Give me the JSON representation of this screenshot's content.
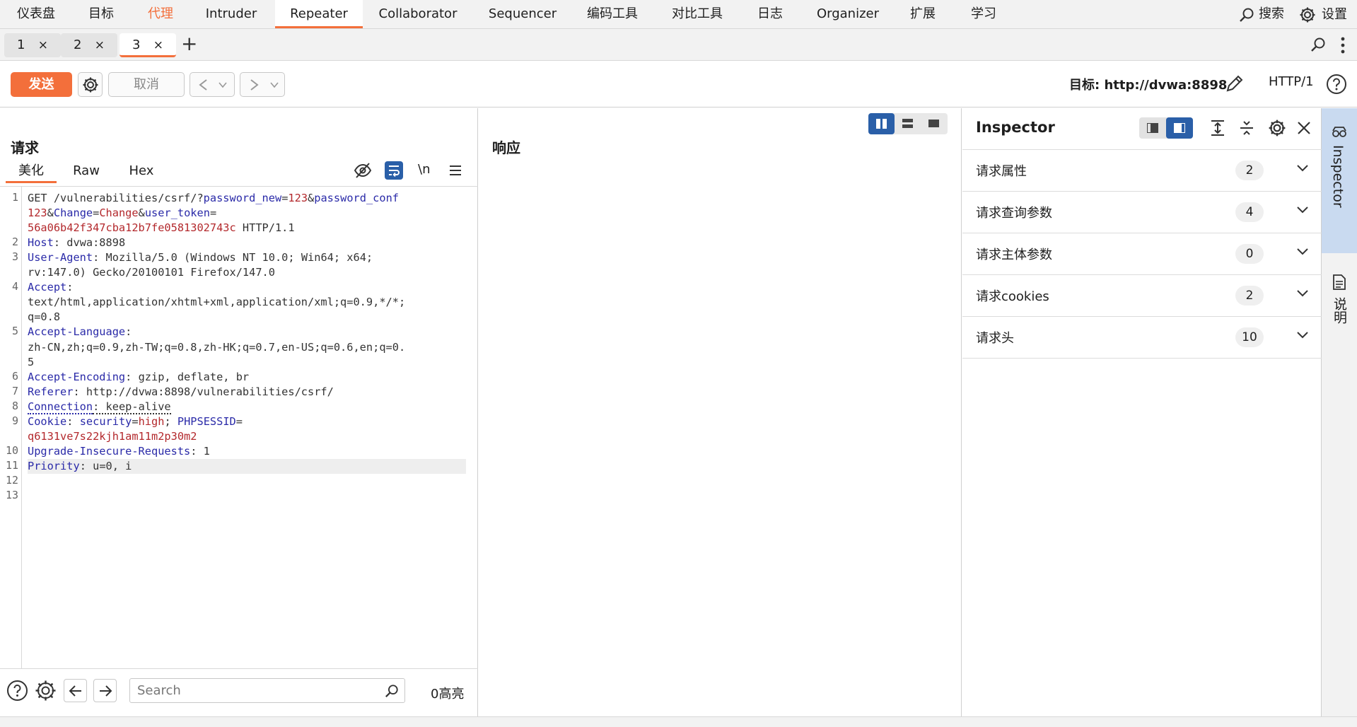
{
  "menu": {
    "items": [
      "仪表盘",
      "目标",
      "代理",
      "Intruder",
      "Repeater",
      "Collaborator",
      "Sequencer",
      "编码工具",
      "对比工具",
      "日志",
      "Organizer",
      "扩展",
      "学习"
    ],
    "search_label": "搜索",
    "settings_label": "设置"
  },
  "tabs": {
    "items": [
      "1",
      "2",
      "3"
    ],
    "close": "×",
    "add": "+"
  },
  "toolbar": {
    "send_label": "发送",
    "cancel_label": "取消",
    "target_label": "目标: http://dvwa:8898",
    "http_version": "HTTP/1"
  },
  "request": {
    "title": "请求",
    "subtabs": [
      "美化",
      "Raw",
      "Hex"
    ],
    "newline_toggle": "\\n",
    "line_numbers": [
      "1",
      "2",
      "3",
      "4",
      "5",
      "6",
      "7",
      "8",
      "9",
      "10",
      "11",
      "12",
      "13"
    ],
    "lines": [
      [
        {
          "t": "GET /vulnerabilities/csrf/?",
          "c": ""
        },
        {
          "t": "password_new",
          "c": "k"
        },
        {
          "t": "=",
          "c": ""
        },
        {
          "t": "123",
          "c": "v"
        },
        {
          "t": "&",
          "c": ""
        },
        {
          "t": "password_conf",
          "c": "k"
        }
      ],
      [
        {
          "t": "123",
          "c": "v"
        },
        {
          "t": "&",
          "c": ""
        },
        {
          "t": "Change",
          "c": "k"
        },
        {
          "t": "=",
          "c": ""
        },
        {
          "t": "Change",
          "c": "v"
        },
        {
          "t": "&",
          "c": ""
        },
        {
          "t": "user_token",
          "c": "k"
        },
        {
          "t": "=",
          "c": ""
        }
      ],
      [
        {
          "t": "56a06b42f347cba12b7fe0581302743c",
          "c": "v"
        },
        {
          "t": " HTTP/1.1",
          "c": ""
        }
      ],
      [
        {
          "t": "Host",
          "c": "k"
        },
        {
          "t": ": dvwa:8898",
          "c": ""
        }
      ],
      [
        {
          "t": "User-Agent",
          "c": "k"
        },
        {
          "t": ": Mozilla/5.0 (Windows NT 10.0; Win64; x64;",
          "c": ""
        }
      ],
      [
        {
          "t": "rv:147.0) Gecko/20100101 Firefox/147.0",
          "c": ""
        }
      ],
      [
        {
          "t": "Accept",
          "c": "k"
        },
        {
          "t": ":",
          "c": ""
        }
      ],
      [
        {
          "t": "text/html,application/xhtml+xml,application/xml;q=0.9,*/*;",
          "c": ""
        }
      ],
      [
        {
          "t": "q=0.8",
          "c": ""
        }
      ],
      [
        {
          "t": "Accept-Language",
          "c": "k"
        },
        {
          "t": ":",
          "c": ""
        }
      ],
      [
        {
          "t": "zh-CN,zh;q=0.9,zh-TW;q=0.8,zh-HK;q=0.7,en-US;q=0.6,en;q=0.",
          "c": ""
        }
      ],
      [
        {
          "t": "5",
          "c": ""
        }
      ],
      [
        {
          "t": "Accept-Encoding",
          "c": "k"
        },
        {
          "t": ": gzip, deflate, br",
          "c": ""
        }
      ],
      [
        {
          "t": "Referer",
          "c": "k"
        },
        {
          "t": ": http://dvwa:8898/vulnerabilities/csrf/",
          "c": ""
        }
      ],
      [
        {
          "t": "Connection",
          "c": "k dot"
        },
        {
          "t": ": keep-alive",
          "c": "dot2"
        }
      ],
      [
        {
          "t": "Cookie",
          "c": "k"
        },
        {
          "t": ": ",
          "c": ""
        },
        {
          "t": "security",
          "c": "k"
        },
        {
          "t": "=",
          "c": ""
        },
        {
          "t": "high",
          "c": "v"
        },
        {
          "t": "; ",
          "c": ""
        },
        {
          "t": "PHPSESSID",
          "c": "k"
        },
        {
          "t": "=",
          "c": ""
        }
      ],
      [
        {
          "t": "q6131ve7s22kjh1am11m2p30m2",
          "c": "v"
        }
      ],
      [
        {
          "t": "Upgrade-Insecure-Requests",
          "c": "k"
        },
        {
          "t": ": 1",
          "c": ""
        }
      ],
      [
        {
          "t": "Priority",
          "c": "k"
        },
        {
          "t": ": u=0, i",
          "c": ""
        }
      ]
    ],
    "search_placeholder": "Search",
    "highlight_count": "0高亮"
  },
  "response": {
    "title": "响应"
  },
  "inspector": {
    "title": "Inspector",
    "rows": [
      {
        "label": "请求属性",
        "count": "2"
      },
      {
        "label": "请求查询参数",
        "count": "4"
      },
      {
        "label": "请求主体参数",
        "count": "0"
      },
      {
        "label": "请求cookies",
        "count": "2"
      },
      {
        "label": "请求头",
        "count": "10"
      }
    ]
  },
  "siderail": {
    "inspector_label": "Inspector",
    "notes_label": "说明"
  },
  "colors": {
    "accent": "#f36f3b",
    "toggle_blue": "#2a5fa8",
    "key_blue": "#2a2aa8",
    "value_red": "#b3282c"
  }
}
